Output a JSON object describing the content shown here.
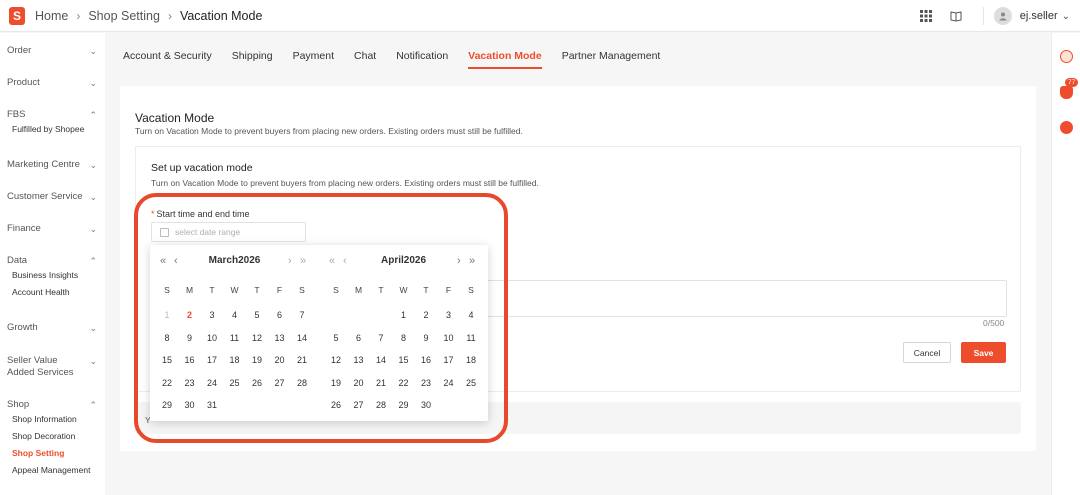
{
  "header": {
    "breadcrumb": [
      "Home",
      "Shop Setting",
      "Vacation Mode"
    ],
    "username": "ej.seller",
    "icons": [
      "grid-icon",
      "book-icon",
      "user-icon",
      "chevron-down-icon"
    ]
  },
  "sidebar": {
    "groups": [
      {
        "title": "Order",
        "expanded": false,
        "items": []
      },
      {
        "title": "Product",
        "expanded": false,
        "items": []
      },
      {
        "title": "FBS",
        "expanded": true,
        "items": [
          "Fulfilled by Shopee"
        ]
      },
      {
        "title": "Marketing Centre",
        "expanded": false,
        "items": []
      },
      {
        "title": "Customer Service",
        "expanded": false,
        "items": []
      },
      {
        "title": "Finance",
        "expanded": false,
        "items": []
      },
      {
        "title": "Data",
        "expanded": true,
        "items": [
          "Business Insights",
          "Account Health"
        ]
      },
      {
        "title": "Growth",
        "expanded": false,
        "items": []
      },
      {
        "title": "Seller Value Added Services",
        "expanded": false,
        "items": []
      },
      {
        "title": "Shop",
        "expanded": true,
        "items": [
          "Shop Information",
          "Shop Decoration",
          "Shop Setting",
          "Appeal Management"
        ]
      }
    ],
    "active_item": "Shop Setting"
  },
  "tabs": [
    "Account & Security",
    "Shipping",
    "Payment",
    "Chat",
    "Notification",
    "Vacation Mode",
    "Partner Management"
  ],
  "active_tab": "Vacation Mode",
  "card": {
    "title": "Vacation Mode",
    "description": "Turn on Vacation Mode to prevent buyers from placing new orders. Existing orders must still be fulfilled.",
    "inner_title": "Set up vacation mode",
    "inner_description": "Turn on Vacation Mode to prevent buyers from placing new orders. Existing orders must still be fulfilled.",
    "field_label": "Start time and end time",
    "date_placeholder": "select date range",
    "char_counter": "0/500",
    "cancel_label": "Cancel",
    "save_label": "Save",
    "footer_text": "Y"
  },
  "calendar": {
    "weekdays": [
      "S",
      "M",
      "T",
      "W",
      "T",
      "F",
      "S"
    ],
    "left_month": {
      "title": "March2026",
      "first_weekday": 0,
      "days": 31,
      "muted_days": [
        1
      ],
      "today": 2
    },
    "right_month": {
      "title": "April2026",
      "first_weekday": 3,
      "days": 30,
      "muted_days": [],
      "today": null
    },
    "nav": {
      "prev_year": "«",
      "prev_month": "‹",
      "next_month": "›",
      "next_year": "»"
    }
  },
  "right_rail": {
    "notification_count": "77"
  },
  "colors": {
    "accent": "#ee4d2d",
    "highlight_ring": "#e8492d"
  }
}
